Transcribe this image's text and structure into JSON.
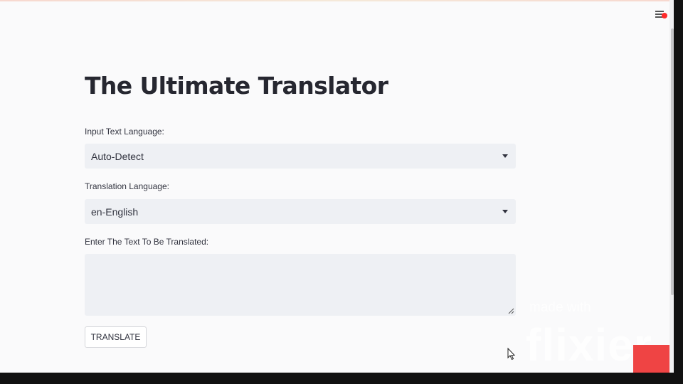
{
  "app": {
    "title": "The Ultimate Translator"
  },
  "form": {
    "input_language": {
      "label": "Input Text Language:",
      "selected": "Auto-Detect"
    },
    "translation_language": {
      "label": "Translation Language:",
      "selected": "en-English"
    },
    "text_input": {
      "label": "Enter The Text To Be Translated:",
      "value": ""
    },
    "translate_button": "TRANSLATE"
  },
  "watermark": {
    "line1": "made with",
    "line2": "flixier"
  },
  "icons": {
    "menu": "hamburger-menu-icon",
    "select_caret": "caret-down-icon",
    "resize": "resize-grip-icon",
    "cursor": "mouse-pointer-icon"
  },
  "colors": {
    "background": "#fafafb",
    "field_background": "#eef0f4",
    "text": "#31333f",
    "title": "#262730",
    "notification_dot": "#ff2a2a",
    "watermark_logo": "#ef4444"
  }
}
